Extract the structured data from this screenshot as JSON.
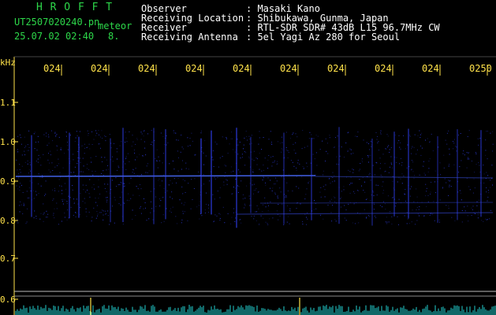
{
  "header": {
    "app_name": "H R O F F T",
    "filename": "UT2507020240.pn",
    "mode": "meteor",
    "datetime": "25.07.02 02:40",
    "count": "8.",
    "labels": {
      "observer": "Observer",
      "location": "Receiving Location",
      "receiver": "Receiver",
      "antenna": "Receiving Antenna"
    },
    "values": {
      "observer": ": Masaki Kano",
      "location": ": Shibukawa, Gunma, Japan",
      "receiver": ": RTL-SDR SDR# 43dB L15 96.7MHz CW",
      "antenna": ": 5el Yagi Az 280 for Seoul"
    }
  },
  "axis": {
    "unit_label": "kHz",
    "x_ticks": [
      "024",
      "024",
      "024",
      "024",
      "024",
      "024",
      "024",
      "024",
      "024",
      "0250"
    ],
    "y_ticks": [
      "1.1",
      "1.0",
      "0.9",
      "0.8",
      "0.7",
      "0.6"
    ]
  },
  "colors": {
    "text_green": "#2dd84a",
    "tick_yellow": "#ffe24a",
    "signal_blue": "#3344ff",
    "spectrum_cyan": "#22d0d0"
  }
}
